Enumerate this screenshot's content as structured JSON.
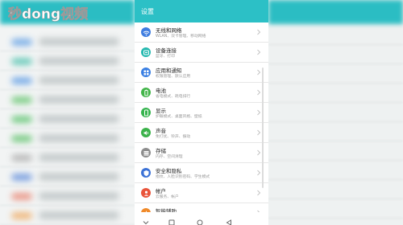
{
  "watermark": {
    "text": "秒dong视频"
  },
  "header": {
    "title": "设置"
  },
  "settings": [
    {
      "title": "无线和网络",
      "subtitle": "WLAN、双卡管理、移动网络",
      "icon": "wifi-icon",
      "color": "#3f7de0"
    },
    {
      "title": "设备连接",
      "subtitle": "蓝牙、打印",
      "icon": "device-connection-icon",
      "color": "#26b9b0"
    },
    {
      "title": "应用和通知",
      "subtitle": "权限管理、默认应用",
      "icon": "apps-icon",
      "color": "#3a7fe3"
    },
    {
      "title": "电池",
      "subtitle": "省电模式、耗电排行",
      "icon": "battery-icon",
      "color": "#43b54a"
    },
    {
      "title": "显示",
      "subtitle": "护眼模式、桌面风格、壁纸",
      "icon": "display-icon",
      "color": "#37b44f"
    },
    {
      "title": "声音",
      "subtitle": "免打扰、铃声、振动",
      "icon": "sound-icon",
      "color": "#3bb24a"
    },
    {
      "title": "存储",
      "subtitle": "内存、空间清理",
      "icon": "storage-icon",
      "color": "#8d8d8d"
    },
    {
      "title": "安全和隐私",
      "subtitle": "指纹、人脸识别密码、学生模式",
      "icon": "security-icon",
      "color": "#3c72d6"
    },
    {
      "title": "帐户",
      "subtitle": "云服务、帐户",
      "icon": "account-icon",
      "color": "#e9553b"
    },
    {
      "title": "智能辅助",
      "subtitle": "",
      "icon": "assist-icon",
      "color": "#f08a2a"
    }
  ],
  "nav": [
    {
      "name": "nav-down-button",
      "icon": "chevron-down-icon"
    },
    {
      "name": "nav-recents-button",
      "icon": "square-icon"
    },
    {
      "name": "nav-home-button",
      "icon": "circle-icon"
    },
    {
      "name": "nav-back-button",
      "icon": "triangle-back-icon"
    }
  ],
  "colors": {
    "accent": "#2cc0c6",
    "background": "#ffffff"
  }
}
